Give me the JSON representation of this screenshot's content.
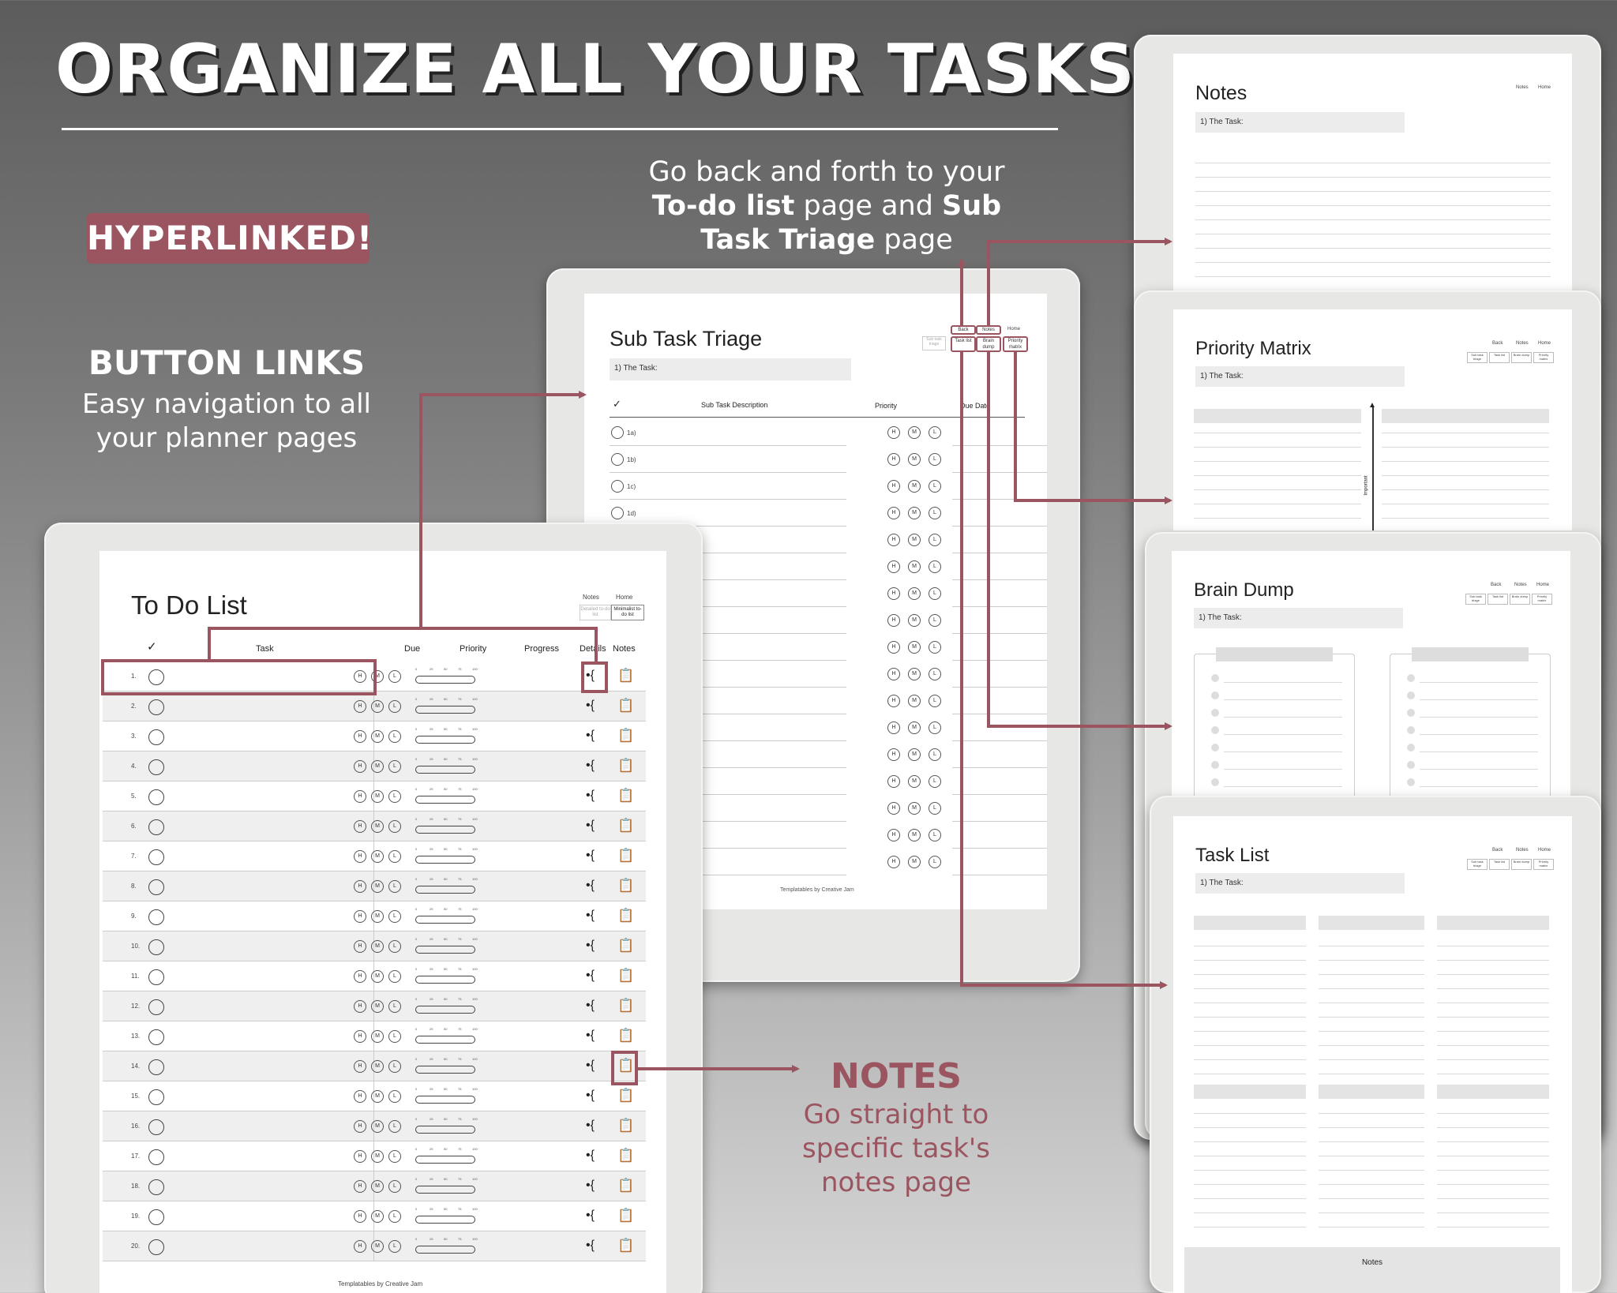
{
  "headline": "ORGANIZE ALL YOUR TASKS",
  "badge": "HYPERLINKED!",
  "button_links": {
    "title": "BUTTON LINKS",
    "line1": "Easy navigation to all",
    "line2": "your planner pages"
  },
  "go_back": {
    "line1": "Go back and forth to your",
    "todo_bold": "To-do list",
    "mid": " page and ",
    "sub_bold": "Sub",
    "line3_bold": "Task Triage",
    "line3_tail": " page"
  },
  "notes_callout": {
    "title": "NOTES",
    "line1": "Go straight to",
    "line2": "specific task's",
    "line3": "notes page"
  },
  "colors": {
    "accent": "#9b5560",
    "paper": "#ffffff",
    "frame": "#e7e8e5"
  },
  "todo": {
    "title_bold": "To Do",
    "title_light": " List",
    "nav": {
      "notes": "Notes",
      "home": "Home",
      "detailed": "Detailed to-do list",
      "minimalist": "Minimalist to-do list"
    },
    "headers": {
      "check": "✓",
      "task": "Task",
      "due": "Due",
      "priority": "Priority",
      "progress": "Progress",
      "details": "Details",
      "notes": "Notes"
    },
    "rows": [
      "1.",
      "2.",
      "3.",
      "4.",
      "5.",
      "6.",
      "7.",
      "8.",
      "9.",
      "10.",
      "11.",
      "12.",
      "13.",
      "14.",
      "15.",
      "16.",
      "17.",
      "18.",
      "19.",
      "20."
    ],
    "priority_letters": [
      "H",
      "M",
      "L"
    ],
    "progress_ticks": [
      "0",
      "25",
      "50",
      "75",
      "100"
    ],
    "footer": "Templatables by Creative Jam"
  },
  "subtask": {
    "title_bold": "Sub Task",
    "title_light": " Triage",
    "task_label": "1) The Task:",
    "nav": {
      "back": "Back",
      "notes": "Notes",
      "home": "Home",
      "subtask": "Sub task triage",
      "tasklist": "Task list",
      "brain": "Brain dump",
      "priority": "Priority matrix"
    },
    "headers": {
      "check": "✓",
      "desc": "Sub Task Description",
      "priority": "Priority",
      "due": "Due Date"
    },
    "rows": [
      "1a)",
      "1b)",
      "1c)",
      "1d)"
    ],
    "footer": "Templatables by Creative Jam"
  },
  "notes_page": {
    "title": "Notes",
    "task_label": "1) The Task:",
    "nav": {
      "notes": "Notes",
      "home": "Home"
    }
  },
  "priority_page": {
    "title_bold": "Priority",
    "title_light": " Matrix",
    "task_label": "1) The Task:",
    "axis": "Important",
    "nav": {
      "back": "Back",
      "notes": "Notes",
      "home": "Home",
      "subtask": "Sub task triage",
      "tasklist": "Task list",
      "brain": "Brain dump",
      "priority": "Priority matrix"
    }
  },
  "brain_page": {
    "title_bold": "Brain",
    "title_light": " Dump",
    "task_label": "1) The Task:",
    "nav": {
      "back": "Back",
      "notes": "Notes",
      "home": "Home",
      "subtask": "Sub task triage",
      "tasklist": "Task list",
      "brain": "Brain dump",
      "priority": "Priority matrix"
    }
  },
  "tasklist_page": {
    "title_bold": "Task",
    "title_light": " List",
    "task_label": "1) The Task:",
    "notes_label": "Notes",
    "nav": {
      "back": "Back",
      "notes": "Notes",
      "home": "Home",
      "subtask": "Sub task triage",
      "tasklist": "Task list",
      "brain": "Brain dump",
      "priority": "Priority matrix"
    }
  }
}
